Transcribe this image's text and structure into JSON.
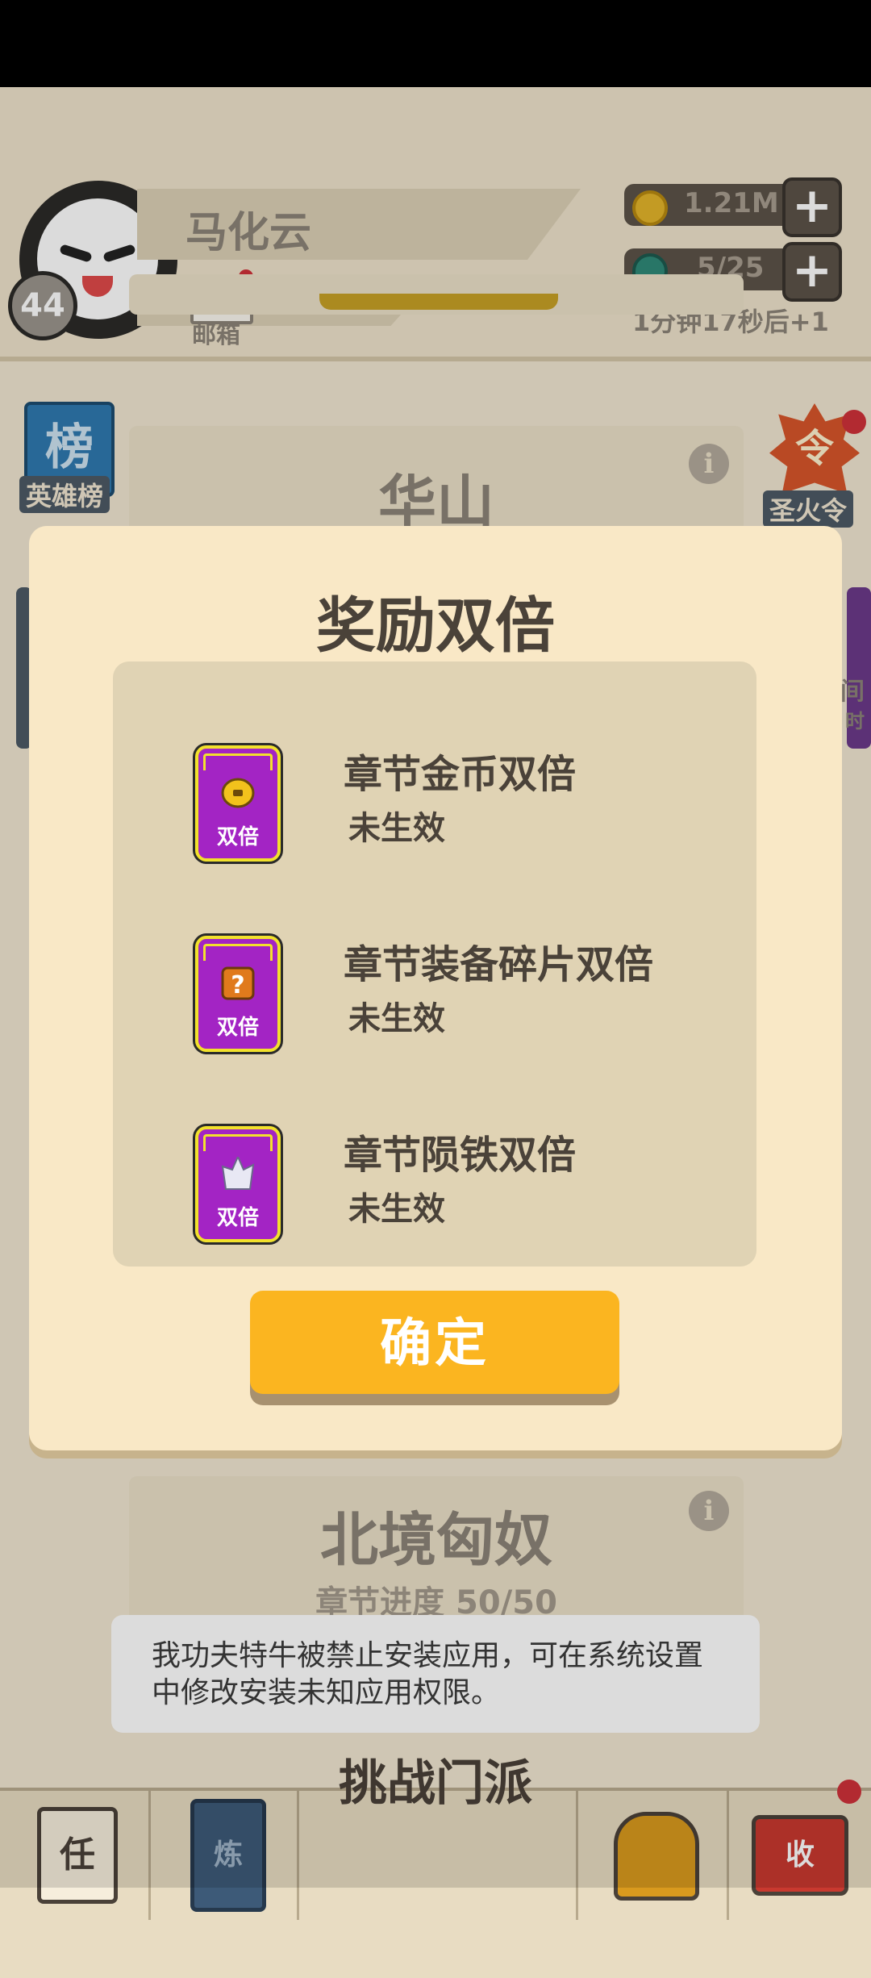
{
  "header": {
    "player_name": "马化云",
    "level": "44",
    "mail_label": "邮箱",
    "gold_amount": "1.21M",
    "stamina": "5/25",
    "stamina_timer": "1分钟17秒后+1"
  },
  "side": {
    "left_top_label": "英雄榜",
    "left_top_icon_text": "榜",
    "right_top_label": "圣火令",
    "right_top_icon_text": "令",
    "right_mid_label": "间",
    "right_mid_sub": "时"
  },
  "chapters": [
    {
      "name": "华山",
      "progress": ""
    },
    {
      "name": "北境匈奴",
      "progress": "章节进度 50/50"
    }
  ],
  "modal": {
    "title": "奖励双倍",
    "rewards": [
      {
        "name": "章节金币双倍",
        "status": "未生效",
        "card_label": "双倍",
        "icon": "coin-icon"
      },
      {
        "name": "章节装备碎片双倍",
        "status": "未生效",
        "card_label": "双倍",
        "icon": "question-box-icon"
      },
      {
        "name": "章节陨铁双倍",
        "status": "未生效",
        "card_label": "双倍",
        "icon": "crystal-icon"
      }
    ],
    "confirm_label": "确定"
  },
  "toast": {
    "message": "我功夫特牛被禁止安装应用，可在系统设置中修改安装未知应用权限。"
  },
  "bottom_nav": {
    "task_icon_text": "任",
    "train_icon_text": "炼",
    "challenge_label": "挑战门派",
    "collect_icon_text": "收"
  },
  "colors": {
    "modal_bg": "#f9e8c6",
    "inner_bg": "#e0d3b4",
    "confirm_bg": "#fbb520",
    "card_purple": "#a324c4",
    "card_border": "#f2e12c"
  }
}
